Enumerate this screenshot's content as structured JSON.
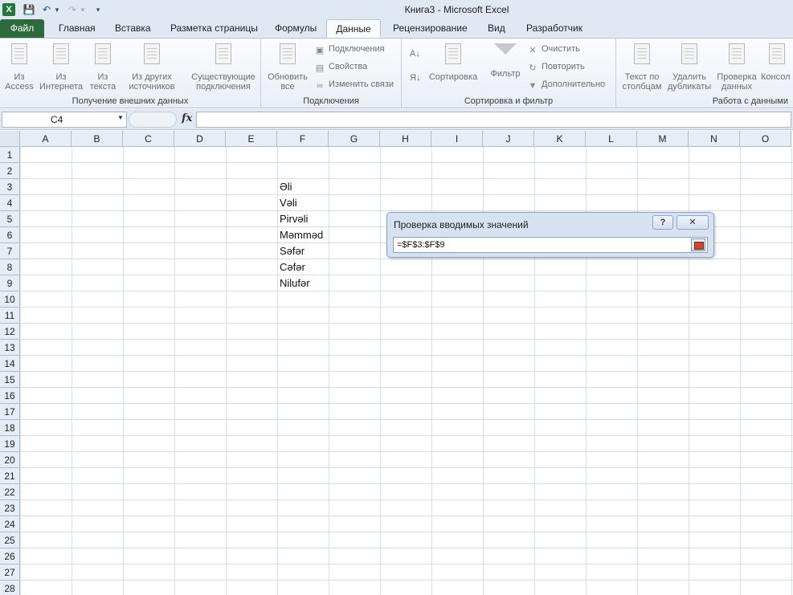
{
  "titlebar": {
    "book_name": "Книга3",
    "separator": "-",
    "app_name": "Microsoft Excel"
  },
  "ribbon_tabs": [
    {
      "label": "Файл",
      "selected": false
    },
    {
      "label": "Главная",
      "selected": false
    },
    {
      "label": "Вставка",
      "selected": false
    },
    {
      "label": "Разметка страницы",
      "selected": false
    },
    {
      "label": "Формулы",
      "selected": false
    },
    {
      "label": "Данные",
      "selected": true
    },
    {
      "label": "Рецензирование",
      "selected": false
    },
    {
      "label": "Вид",
      "selected": false
    },
    {
      "label": "Разработчик",
      "selected": false
    }
  ],
  "ribbon": {
    "external_data": {
      "label": "Получение внешних данных",
      "buttons": [
        {
          "line1": "Из",
          "line2": "Access"
        },
        {
          "line1": "Из",
          "line2": "Интернета"
        },
        {
          "line1": "Из",
          "line2": "текста"
        },
        {
          "line1": "Из других",
          "line2": "источников"
        },
        {
          "line1": "Существующие",
          "line2": "подключения"
        }
      ]
    },
    "connections": {
      "label": "Подключения",
      "refresh_line1": "Обновить",
      "refresh_line2": "все",
      "items": [
        "Подключения",
        "Свойства",
        "Изменить связи"
      ]
    },
    "sort_filter": {
      "label": "Сортировка и фильтр",
      "sort": "Сортировка",
      "filter": "Фильтр",
      "items": [
        "Очистить",
        "Повторить",
        "Дополнительно"
      ]
    },
    "data_tools": {
      "label": "Работа с данными",
      "buttons": [
        {
          "line1": "Текст по",
          "line2": "столбцам"
        },
        {
          "line1": "Удалить",
          "line2": "дубликаты"
        },
        {
          "line1": "Проверка",
          "line2": "данных"
        },
        {
          "line1": "Консол",
          "line2": ""
        }
      ]
    }
  },
  "formula_bar": {
    "name_box": "C4",
    "fx": "fx",
    "formula": ""
  },
  "sheet": {
    "columns": [
      "A",
      "B",
      "C",
      "D",
      "E",
      "F",
      "G",
      "H",
      "I",
      "J",
      "K",
      "L",
      "M",
      "N",
      "O"
    ],
    "rows": [
      "1",
      "2",
      "3",
      "4",
      "5",
      "6",
      "7",
      "8",
      "9",
      "10",
      "11",
      "12",
      "13",
      "14",
      "15",
      "16",
      "17",
      "18",
      "19",
      "20",
      "21",
      "22",
      "23",
      "24",
      "25",
      "26",
      "27",
      "28"
    ],
    "cells": [
      {
        "ref": "F3",
        "value": "Əli"
      },
      {
        "ref": "F4",
        "value": "Vəli"
      },
      {
        "ref": "F5",
        "value": "Pirvəli"
      },
      {
        "ref": "F6",
        "value": "Məmməd"
      },
      {
        "ref": "F7",
        "value": "Səfər"
      },
      {
        "ref": "F8",
        "value": "Cəfər"
      },
      {
        "ref": "F9",
        "value": "Nilufər"
      }
    ]
  },
  "dialog": {
    "title": "Проверка вводимых значений",
    "help_label": "?",
    "close_label": "✕",
    "input_value": "=$F$3:$F$9"
  }
}
